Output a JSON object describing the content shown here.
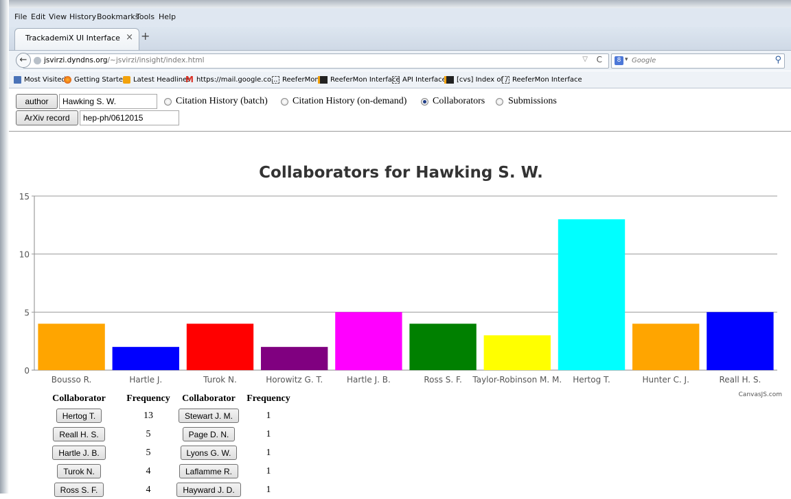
{
  "menu": [
    "File",
    "Edit",
    "View",
    "History",
    "Bookmarks",
    "Tools",
    "Help"
  ],
  "tab": {
    "title": "TrackademiX UI Interface",
    "close": "×",
    "new": "+"
  },
  "nav": {
    "url_host": "jsvirzi.dyndns.org",
    "url_path": "/~jsvirzi/insight/index.html",
    "search_placeholder": "Google",
    "search_engine": "8"
  },
  "bookmarks": [
    {
      "label": "Most Visited",
      "icon": "most-visited-icon"
    },
    {
      "label": "Getting Started",
      "icon": "firefox-icon"
    },
    {
      "label": "Latest Headlines",
      "icon": "rss-icon"
    },
    {
      "label": "https://mail.google.co...",
      "icon": "gmail-icon"
    },
    {
      "label": "ReeferMon",
      "icon": "page-icon"
    },
    {
      "label": "ReeferMon Interface",
      "icon": "reefer-icon"
    },
    {
      "label": "API Interface",
      "icon": "page-icon"
    },
    {
      "label": "[cvs] Index of /",
      "icon": "reefer-icon"
    },
    {
      "label": "ReeferMon Interface",
      "icon": "page-icon"
    }
  ],
  "form": {
    "author_button": "author",
    "author_value": "Hawking S. W.",
    "arxiv_button": "ArXiv record",
    "arxiv_value": "hep-ph/0612015",
    "radios": [
      {
        "label": "Citation History (batch)",
        "checked": false
      },
      {
        "label": "Citation History (on-demand)",
        "checked": false
      },
      {
        "label": "Collaborators",
        "checked": true
      },
      {
        "label": "Submissions",
        "checked": false
      }
    ]
  },
  "chart_data": {
    "type": "bar",
    "title": "Collaborators for Hawking S. W.",
    "categories": [
      "Bousso R.",
      "Hartle J.",
      "Turok N.",
      "Horowitz G. T.",
      "Hartle J. B.",
      "Ross S. F.",
      "Taylor-Robinson M. M.",
      "Hertog T.",
      "Hunter C. J.",
      "Reall H. S."
    ],
    "values": [
      4,
      2,
      4,
      2,
      5,
      4,
      3,
      13,
      4,
      5
    ],
    "colors": [
      "#ffa500",
      "#0000ff",
      "#ff0000",
      "#800080",
      "#ff00ff",
      "#008000",
      "#ffff00",
      "#00ffff",
      "#ffa500",
      "#0000ff"
    ],
    "ylim": [
      0,
      15
    ],
    "yticks": [
      0,
      5,
      10,
      15
    ],
    "grid": true,
    "credit": "CanvasJS.com"
  },
  "table": {
    "headers": [
      "Collaborator",
      "Frequency",
      "Collaborator",
      "Frequency"
    ],
    "rows": [
      {
        "name1": "Hertog T.",
        "freq1": "13",
        "name2": "Stewart J. M.",
        "freq2": "1"
      },
      {
        "name1": "Reall H. S.",
        "freq1": "5",
        "name2": "Page D. N.",
        "freq2": "1"
      },
      {
        "name1": "Hartle J. B.",
        "freq1": "5",
        "name2": "Lyons G. W.",
        "freq2": "1"
      },
      {
        "name1": "Turok N.",
        "freq1": "4",
        "name2": "Laflamme R.",
        "freq2": "1"
      },
      {
        "name1": "Ross S. F.",
        "freq1": "4",
        "name2": "Hayward J. D.",
        "freq2": "1"
      }
    ]
  }
}
